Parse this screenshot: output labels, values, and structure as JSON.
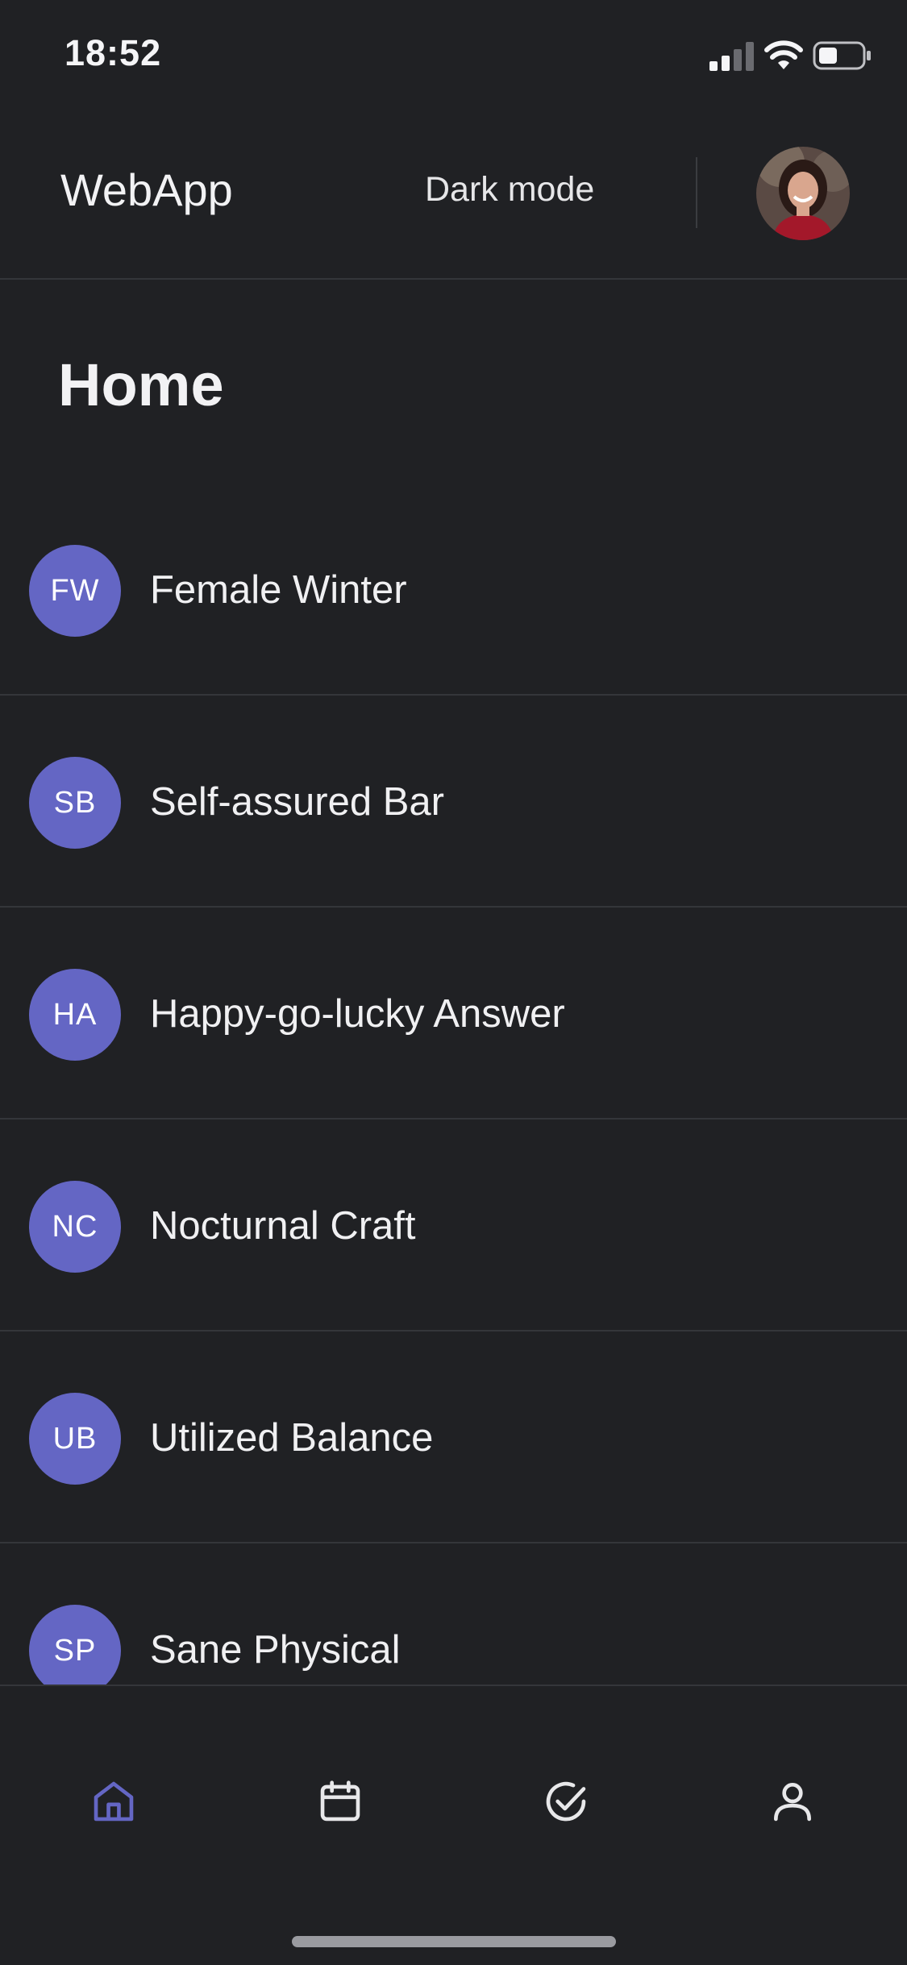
{
  "status_bar": {
    "time": "18:52"
  },
  "header": {
    "app_title": "WebApp",
    "mode_toggle_label": "Dark mode"
  },
  "page": {
    "title": "Home"
  },
  "list": {
    "items": [
      {
        "initials": "FW",
        "label": "Female Winter"
      },
      {
        "initials": "SB",
        "label": "Self-assured Bar"
      },
      {
        "initials": "HA",
        "label": "Happy-go-lucky Answer"
      },
      {
        "initials": "NC",
        "label": "Nocturnal Craft"
      },
      {
        "initials": "UB",
        "label": "Utilized Balance"
      },
      {
        "initials": "SP",
        "label": "Sane Physical"
      }
    ]
  },
  "bottom_nav": {
    "items": [
      {
        "icon": "home-icon",
        "active": true
      },
      {
        "icon": "calendar-icon",
        "active": false
      },
      {
        "icon": "check-circle-icon",
        "active": false
      },
      {
        "icon": "user-icon",
        "active": false
      }
    ]
  },
  "colors": {
    "background": "#202124",
    "accent": "#6466c4",
    "text": "#f0f0f2",
    "divider": "#34363a"
  }
}
